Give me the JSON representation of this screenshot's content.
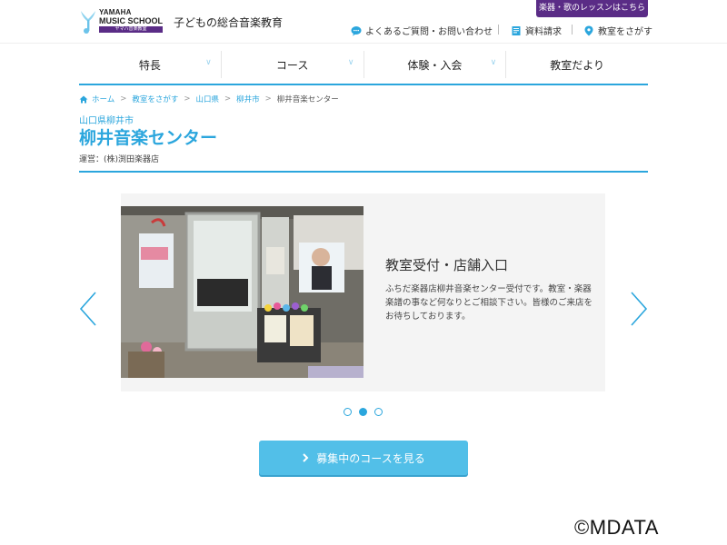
{
  "header": {
    "logo": {
      "line1": "YAMAHA",
      "line2": "MUSIC SCHOOL",
      "line3": "ヤマハ音楽教室"
    },
    "tagline": "子どもの総合音楽教育",
    "promo_label": "楽器・歌のレッスンはこちら",
    "utility": [
      {
        "icon": "chat-icon",
        "label": "よくあるご質問・お問い合わせ"
      },
      {
        "icon": "document-icon",
        "label": "資料請求"
      },
      {
        "icon": "location-pin-icon",
        "label": "教室をさがす"
      }
    ]
  },
  "nav": {
    "items": [
      {
        "label": "特長",
        "has_dropdown": true
      },
      {
        "label": "コース",
        "has_dropdown": true
      },
      {
        "label": "体験・入会",
        "has_dropdown": true
      },
      {
        "label": "教室だより",
        "has_dropdown": false
      }
    ]
  },
  "breadcrumb": {
    "items": [
      "ホーム",
      "教室をさがす",
      "山口県",
      "柳井市"
    ],
    "current": "柳井音楽センター",
    "separator": ">"
  },
  "page": {
    "prefecture_city": "山口県柳井市",
    "title": "柳井音楽センター",
    "operator": "運営：(株)渕田楽器店"
  },
  "slider": {
    "slide_title": "教室受付・店舗入口",
    "slide_text": "ふちだ楽器店柳井音楽センター受付です。教室・楽器楽譜の事など何なりとご相談下さい。皆様のご来店をお待ちしております。",
    "total_slides": 3,
    "active_index": 1
  },
  "cta": {
    "label": "募集中のコースを見る",
    "icon": "chevron-right-icon"
  },
  "watermark": "©MDATA",
  "colors": {
    "accent": "#2ba6dd",
    "purple": "#5a2c86",
    "button": "#52bfe8"
  }
}
